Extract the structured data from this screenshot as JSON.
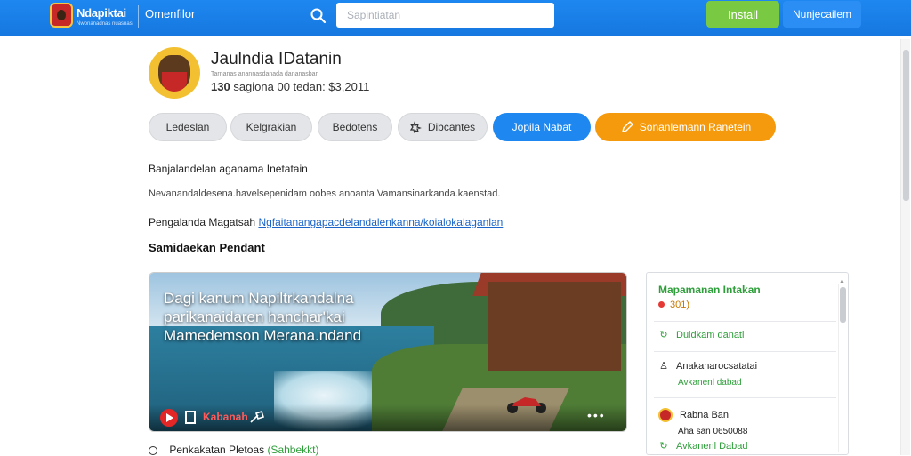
{
  "header": {
    "brand_title": "Ndapiktai",
    "brand_subtitle": "Nwonanadnas nuasnas",
    "nav_link": "Omenfilor",
    "search_placeholder": "Sapintiatan",
    "install_label": "Instail",
    "info_label": "Nunjecailem"
  },
  "profile": {
    "name": "Jaulndia IDatanin",
    "handle": "Tarnanas anannasdanada dananasban",
    "stats_count": "130",
    "stats_text": "sagiona 00 tedan: $3,2011"
  },
  "tabs": [
    {
      "label": "Ledeslan"
    },
    {
      "label": "Kelgrakian"
    },
    {
      "label": "Bedotens"
    },
    {
      "label": "Dibcantes",
      "icon": "puzzle-icon"
    },
    {
      "label": "Jopila Nabat"
    },
    {
      "label": "Sonanlemann Ranetein",
      "icon": "pencil-icon"
    }
  ],
  "content": {
    "line1": "Banjalandelan aganama Inetatain",
    "line2": "Nevanandaldesena.havelsepenidam oobes anoanta Vamansinarkanda.kaenstad.",
    "line3_label": "Pengalanda Magatsah",
    "line3_link": "Ngfaitanangapacdelandalenkanna/koialokalaganlan",
    "section_title": "Samidaekan Pendant"
  },
  "video": {
    "title": "Dagi kanum Napiltrkandalna parikanaidaren hanchar'kai Mamedemson Merana.ndand",
    "label": "Kabanah",
    "below_text": "Penkakatan Pletoas",
    "below_link": "(Sahbekkt)"
  },
  "panel": {
    "title": "Mapamanan Intakan",
    "count": "301)",
    "rows": [
      {
        "label": "Duidkam danati",
        "icon": "refresh-icon",
        "sub": ""
      },
      {
        "label": "Anakanarocsatatai",
        "icon": "user-icon",
        "sub": "Avkanenl dabad"
      },
      {
        "label": "Rabna Ban",
        "icon": "avatar",
        "sub": "Aha san 0650088"
      },
      {
        "label": "",
        "icon": "refresh-icon",
        "sub": "Avkanenl Dabad"
      }
    ]
  },
  "colors": {
    "topbar": "#1677e0",
    "install": "#7ac943",
    "accent_blue": "#1e88f0",
    "accent_orange": "#f59a0c",
    "panel_green": "#2e9e3a"
  }
}
